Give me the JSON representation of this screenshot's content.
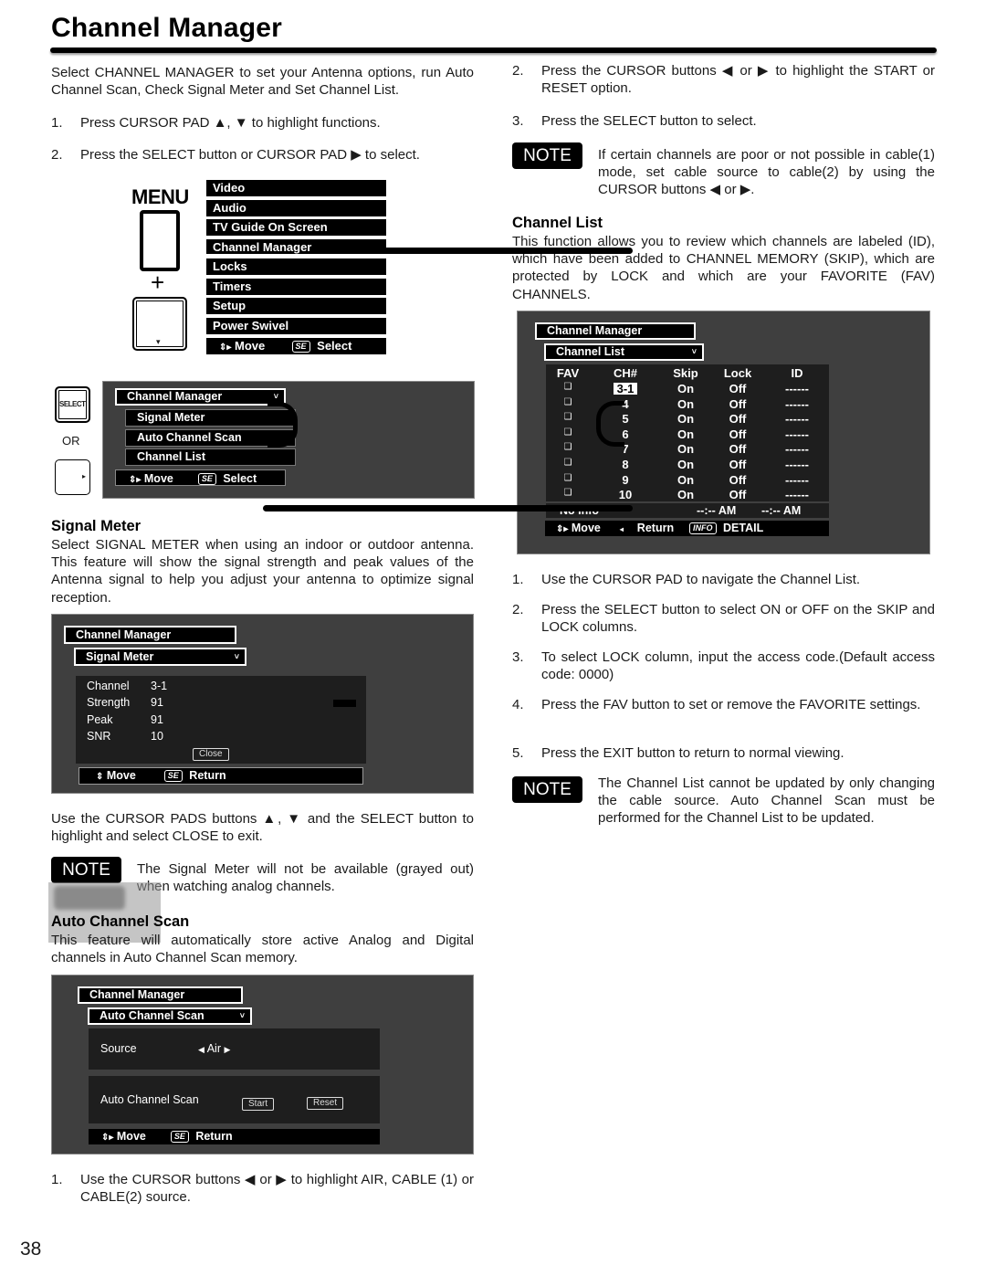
{
  "page": {
    "title": "Channel Manager",
    "page_number": "38"
  },
  "intro": {
    "text": "Select CHANNEL MANAGER to set your Antenna options, run Auto Channel Scan, Check Signal Meter and Set Channel List.",
    "steps": [
      {
        "num": "1.",
        "text": "Press CURSOR PAD ▲, ▼ to highlight functions."
      },
      {
        "num": "2.",
        "text": "Press the SELECT button or CURSOR PAD ▶ to select."
      }
    ]
  },
  "remote": {
    "menu_label": "MENU",
    "plus": "+",
    "select_label": "SELECT",
    "or_label": "OR",
    "down_arrow": "▾",
    "right_arrow": "▸"
  },
  "main_menu": {
    "items": [
      "Video",
      "Audio",
      "TV Guide On Screen",
      "Channel Manager",
      "Locks",
      "Timers",
      "Setup",
      "Power Swivel"
    ],
    "footer_move": "Move",
    "footer_se": "SE",
    "footer_select": "Select"
  },
  "cm_menu": {
    "header": "Channel Manager",
    "chevron": "˅",
    "items": [
      "Signal Meter",
      "Auto Channel Scan",
      "Channel List"
    ],
    "footer_move": "Move",
    "footer_se": "SE",
    "footer_select": "Select"
  },
  "signal_meter": {
    "heading": "Signal Meter",
    "text": "Select SIGNAL METER when using an indoor or outdoor antenna. This feature will show the signal strength and peak values of the Antenna signal to help you adjust your antenna to optimize signal reception.",
    "osd": {
      "header": "Channel Manager",
      "tab": "Signal Meter",
      "rows": [
        {
          "label": "Channel",
          "value": "3-1"
        },
        {
          "label": "Strength",
          "value": "91"
        },
        {
          "label": "Peak",
          "value": "91"
        },
        {
          "label": "SNR",
          "value": "10"
        }
      ],
      "close_label": "Close",
      "footer_move": "Move",
      "footer_se": "SE",
      "footer_return": "Return"
    },
    "after_text": "Use the CURSOR PADS buttons ▲, ▼ and the SELECT button to highlight and select CLOSE to exit.",
    "note_label": "NOTE",
    "note_text": "The Signal Meter will not be available (grayed out) when watching analog channels."
  },
  "auto_scan": {
    "heading": "Auto Channel Scan",
    "text": "This feature will automatically store active Analog and Digital channels in Auto Channel Scan memory.",
    "osd": {
      "header": "Channel Manager",
      "tab": "Auto Channel Scan",
      "source_label": "Source",
      "source_value": "Air",
      "left_arrow": "◀",
      "right_arrow": "▶",
      "scan_label": "Auto Channel Scan",
      "start_label": "Start",
      "reset_label": "Reset",
      "footer_move": "Move",
      "footer_se": "SE",
      "footer_return": "Return"
    },
    "steps": [
      {
        "num": "1.",
        "text": "Use the CURSOR buttons ◀ or ▶ to highlight AIR, CABLE (1) or CABLE(2) source."
      },
      {
        "num": "2.",
        "text": "Press the CURSOR buttons ◀ or ▶ to highlight the START or RESET option."
      },
      {
        "num": "3.",
        "text": "Press the SELECT button to select."
      }
    ],
    "note_label": "NOTE",
    "note_text": "If certain channels are poor or not possible in cable(1) mode, set cable source to cable(2) by using the CURSOR buttons ◀ or ▶."
  },
  "channel_list": {
    "heading": "Channel List",
    "text": "This function allows you to review which channels are labeled (ID), which have been added to CHANNEL MEMORY (SKIP), which are protected by LOCK and which are your FAVORITE (FAV) CHANNELS.",
    "osd": {
      "header": "Channel Manager",
      "tab": "Channel List",
      "columns": [
        "FAV",
        "CH#",
        "Skip",
        "Lock",
        "ID"
      ],
      "rows": [
        {
          "fav": "❏",
          "ch": "3-1",
          "skip": "On",
          "lock": "Off",
          "id": "------",
          "selected": true
        },
        {
          "fav": "❏",
          "ch": "4",
          "skip": "On",
          "lock": "Off",
          "id": "------"
        },
        {
          "fav": "❏",
          "ch": "5",
          "skip": "On",
          "lock": "Off",
          "id": "------"
        },
        {
          "fav": "❏",
          "ch": "6",
          "skip": "On",
          "lock": "Off",
          "id": "------"
        },
        {
          "fav": "❏",
          "ch": "7",
          "skip": "On",
          "lock": "Off",
          "id": "------"
        },
        {
          "fav": "❏",
          "ch": "8",
          "skip": "On",
          "lock": "Off",
          "id": "------"
        },
        {
          "fav": "❏",
          "ch": "9",
          "skip": "On",
          "lock": "Off",
          "id": "------"
        },
        {
          "fav": "❏",
          "ch": "10",
          "skip": "On",
          "lock": "Off",
          "id": "------"
        }
      ],
      "info_row": {
        "label": "No Info",
        "time1": "--:-- AM",
        "time2": "--:-- AM"
      },
      "footer_move": "Move",
      "footer_return": "Return",
      "footer_info": "INFO",
      "footer_detail": "DETAIL"
    },
    "steps": [
      {
        "num": "1.",
        "text": "Use the CURSOR PAD to navigate the Channel List."
      },
      {
        "num": "2.",
        "text": "Press the SELECT button to select ON or OFF on the SKIP and LOCK columns."
      },
      {
        "num": "3.",
        "text": "To select LOCK column, input the access code.(Default access code: 0000)"
      },
      {
        "num": "4.",
        "text": "Press the FAV button to set or remove the FAVORITE settings."
      },
      {
        "num": "5.",
        "text": "Press the EXIT button to return to normal viewing."
      }
    ],
    "note_label": "NOTE",
    "note_text": "The Channel List cannot be updated by only changing the cable source. Auto Channel Scan must be performed for the Channel List to be updated."
  }
}
